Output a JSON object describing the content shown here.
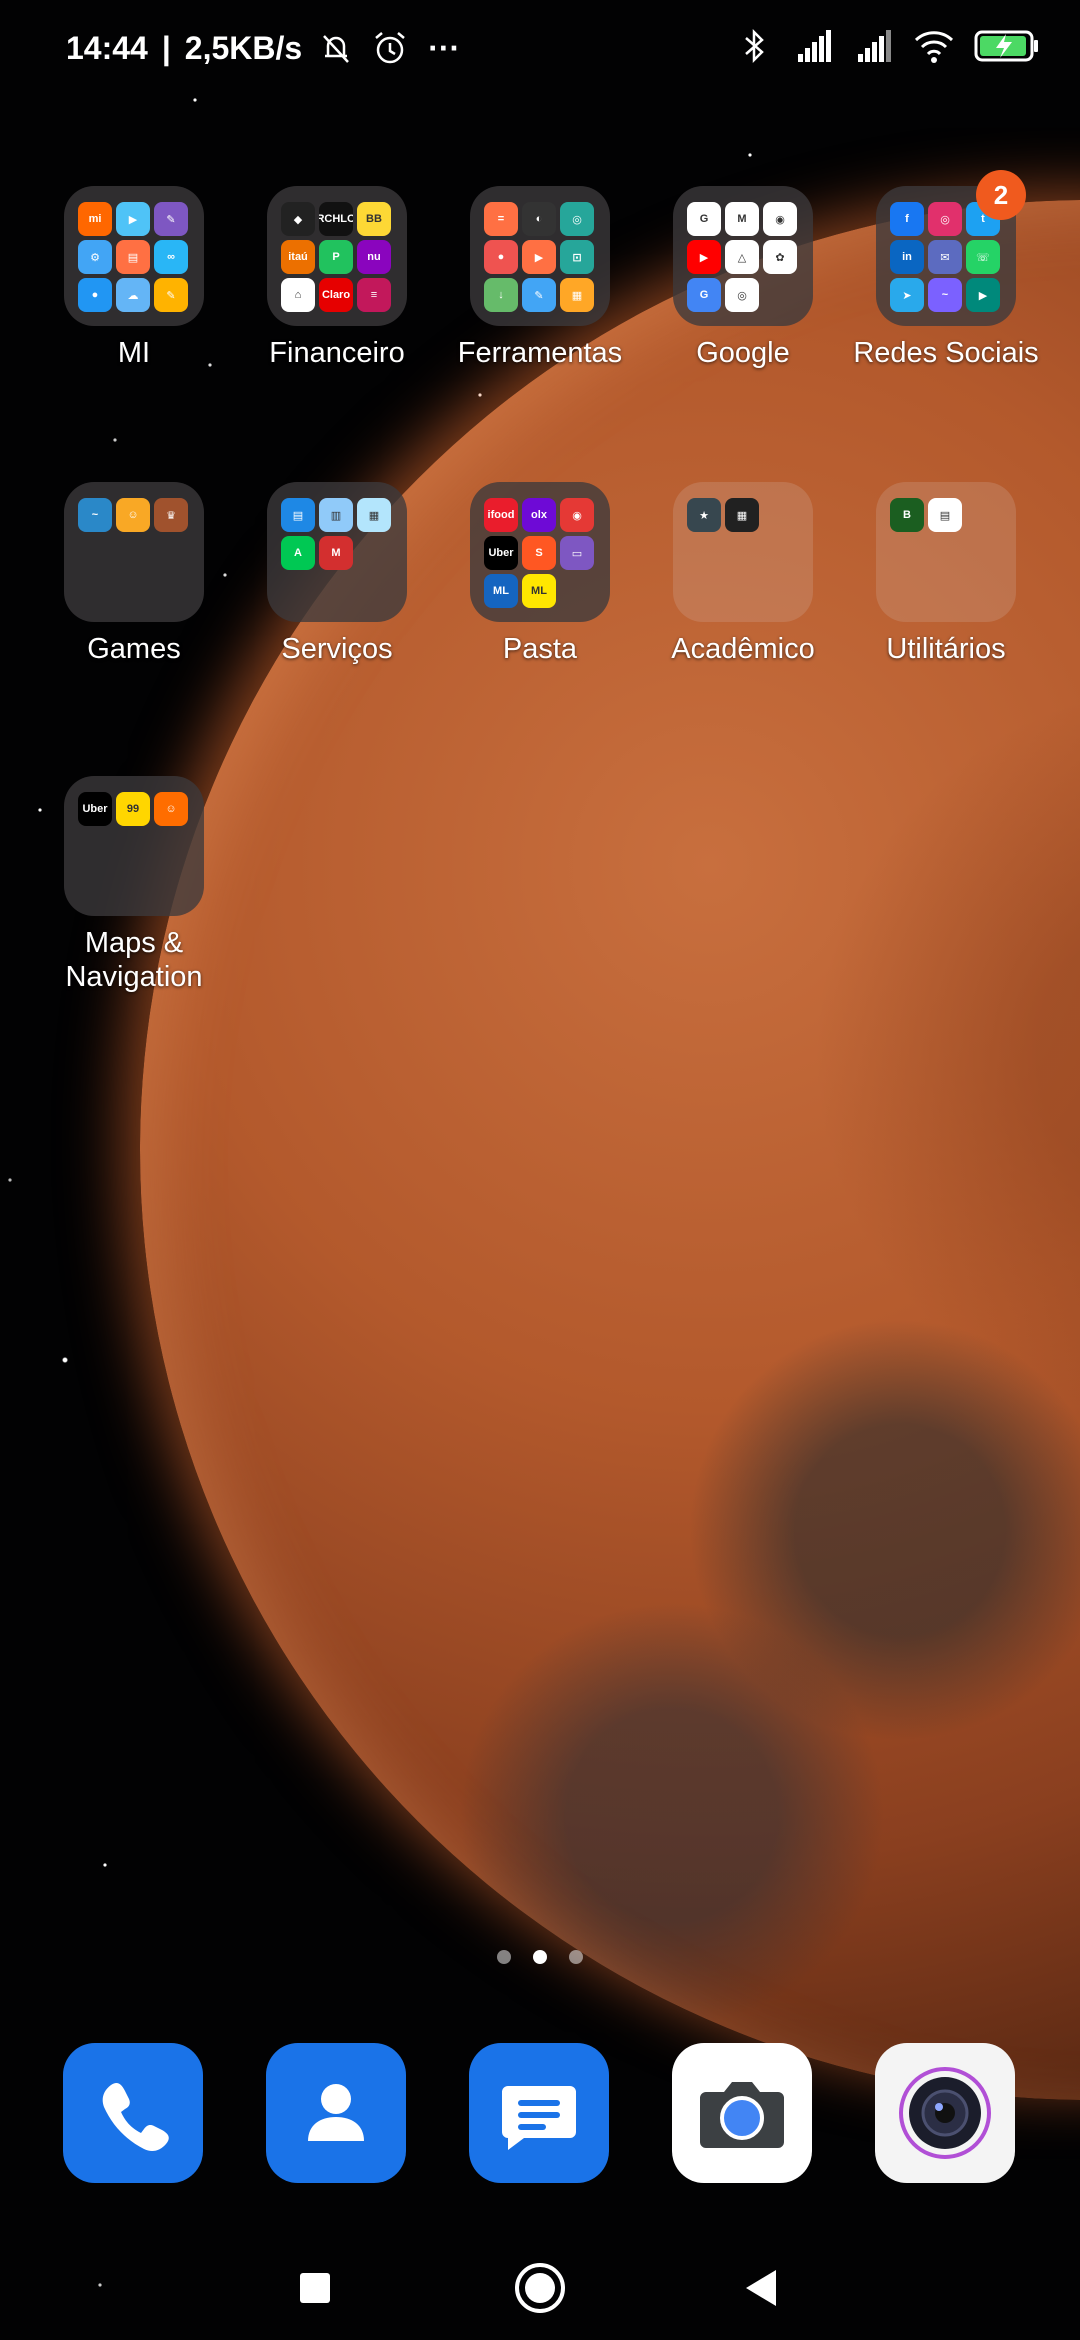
{
  "status_bar": {
    "time": "14:44",
    "separator": "|",
    "net_speed": "2,5KB/s",
    "more": "···",
    "icons": [
      "mute-bell-icon",
      "alarm-icon",
      "bluetooth-icon",
      "signal-icon",
      "signal-icon",
      "wifi-icon",
      "battery-charging-icon"
    ]
  },
  "folders": [
    {
      "label": "MI",
      "apps": [
        {
          "t": "mi",
          "c": "#ff6700"
        },
        {
          "t": "▶",
          "c": "#4fc3f7"
        },
        {
          "t": "✎",
          "c": "#7e57c2"
        },
        {
          "t": "⚙",
          "c": "#42a5f5"
        },
        {
          "t": "▤",
          "c": "#ff7043"
        },
        {
          "t": "∞",
          "c": "#29b6f6"
        },
        {
          "t": "●",
          "c": "#2196f3"
        },
        {
          "t": "☁",
          "c": "#64b5f6"
        },
        {
          "t": "✎",
          "c": "#ffb300"
        }
      ]
    },
    {
      "label": "Financeiro",
      "apps": [
        {
          "t": "◆",
          "c": "#222"
        },
        {
          "t": "RCHLO",
          "c": "#111"
        },
        {
          "t": "BB",
          "c": "#fdd835"
        },
        {
          "t": "itaú",
          "c": "#ec7000"
        },
        {
          "t": "P",
          "c": "#21c25e"
        },
        {
          "t": "nu",
          "c": "#8a05be"
        },
        {
          "t": "⌂",
          "c": "#fff"
        },
        {
          "t": "Claro",
          "c": "#e60000"
        },
        {
          "t": "≡",
          "c": "#c2185b"
        }
      ]
    },
    {
      "label": "Ferramentas",
      "apps": [
        {
          "t": "=",
          "c": "#ff7043"
        },
        {
          "t": "◐",
          "c": "#333"
        },
        {
          "t": "◎",
          "c": "#26a69a"
        },
        {
          "t": "●",
          "c": "#ef5350"
        },
        {
          "t": "▶",
          "c": "#ff7043"
        },
        {
          "t": "⊡",
          "c": "#26a69a"
        },
        {
          "t": "↓",
          "c": "#66bb6a"
        },
        {
          "t": "✎",
          "c": "#42a5f5"
        },
        {
          "t": "▦",
          "c": "#ffa726"
        }
      ]
    },
    {
      "label": "Google",
      "apps": [
        {
          "t": "G",
          "c": "#fff"
        },
        {
          "t": "M",
          "c": "#fff"
        },
        {
          "t": "◉",
          "c": "#fff"
        },
        {
          "t": "▶",
          "c": "#ff0000"
        },
        {
          "t": "△",
          "c": "#fff"
        },
        {
          "t": "✿",
          "c": "#fff"
        },
        {
          "t": "G",
          "c": "#4285f4"
        },
        {
          "t": "◎",
          "c": "#fff"
        }
      ]
    },
    {
      "label": "Redes Sociais",
      "badge": "2",
      "apps": [
        {
          "t": "f",
          "c": "#1877f2"
        },
        {
          "t": "◎",
          "c": "#e1306c"
        },
        {
          "t": "t",
          "c": "#1da1f2"
        },
        {
          "t": "in",
          "c": "#0a66c2"
        },
        {
          "t": "✉",
          "c": "#5c6bc0"
        },
        {
          "t": "☏",
          "c": "#25d366"
        },
        {
          "t": "➤",
          "c": "#29a9eb"
        },
        {
          "t": "~",
          "c": "#7b61ff"
        },
        {
          "t": "▶",
          "c": "#00897b"
        }
      ]
    },
    {
      "label": "Games",
      "apps": [
        {
          "t": "~",
          "c": "#2a88c8"
        },
        {
          "t": "☺",
          "c": "#f9a825"
        },
        {
          "t": "♛",
          "c": "#a0522d"
        }
      ]
    },
    {
      "label": "Serviços",
      "apps": [
        {
          "t": "▤",
          "c": "#1e88e5"
        },
        {
          "t": "▥",
          "c": "#90caf9"
        },
        {
          "t": "▦",
          "c": "#b3e5fc"
        },
        {
          "t": "A",
          "c": "#00c853"
        },
        {
          "t": "M",
          "c": "#d32f2f"
        }
      ]
    },
    {
      "label": "Pasta",
      "apps": [
        {
          "t": "ifood",
          "c": "#ea1d2c"
        },
        {
          "t": "olx",
          "c": "#6e0ad6"
        },
        {
          "t": "◉",
          "c": "#e53935"
        },
        {
          "t": "Uber",
          "c": "#000"
        },
        {
          "t": "S",
          "c": "#ff5722"
        },
        {
          "t": "▭",
          "c": "#7e57c2"
        },
        {
          "t": "ML",
          "c": "#1565c0"
        },
        {
          "t": "ML",
          "c": "#ffe600"
        }
      ]
    },
    {
      "label": "Acadêmico",
      "trans": true,
      "apps": [
        {
          "t": "★",
          "c": "#37474f"
        },
        {
          "t": "▦",
          "c": "#212121"
        }
      ]
    },
    {
      "label": "Utilitários",
      "trans": true,
      "apps": [
        {
          "t": "B",
          "c": "#1b5e20"
        },
        {
          "t": "▤",
          "c": "#fff"
        }
      ]
    },
    {
      "label": "Maps & Navigation",
      "apps": [
        {
          "t": "Uber",
          "c": "#000"
        },
        {
          "t": "99",
          "c": "#ffd600"
        },
        {
          "t": "☺",
          "c": "#ff6d00"
        }
      ]
    }
  ],
  "dock": [
    {
      "name": "phone",
      "icon": "phone-icon",
      "color": "#1a73e8"
    },
    {
      "name": "contacts",
      "icon": "person-icon",
      "color": "#1a73e8"
    },
    {
      "name": "messages",
      "icon": "message-icon",
      "color": "#1a73e8"
    },
    {
      "name": "camera",
      "icon": "camera-icon",
      "color": "#ffffff"
    },
    {
      "name": "mi-camera",
      "icon": "lens-icon",
      "color": "#f2f2f2"
    }
  ],
  "pages": {
    "count": 3,
    "active": 1
  }
}
